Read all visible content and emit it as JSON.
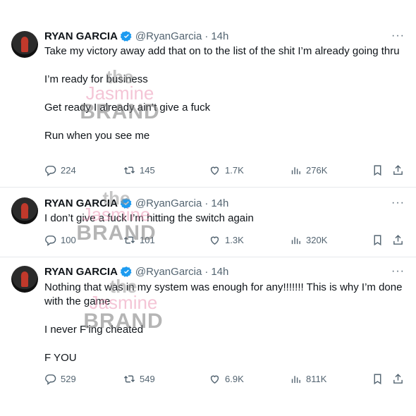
{
  "tweets": [
    {
      "name": "RYAN GARCIA",
      "handle": "@RyanGarcia",
      "dot": "·",
      "time": "14h",
      "lines": [
        "Take my victory away add that on to the list of the shit I’m already going thru",
        "",
        "I’m ready for business",
        "",
        "Get ready I already ain’t give a fuck",
        "",
        "Run when you see me"
      ],
      "replies": "224",
      "retweets": "145",
      "likes": "1.7K",
      "views": "276K"
    },
    {
      "name": "RYAN GARCIA",
      "handle": "@RyanGarcia",
      "dot": "·",
      "time": "14h",
      "lines": [
        "I don’t give a fuck I’m hitting the switch again"
      ],
      "replies": "100",
      "retweets": "101",
      "likes": "1.3K",
      "views": "320K"
    },
    {
      "name": "RYAN GARCIA",
      "handle": "@RyanGarcia",
      "dot": "·",
      "time": "14h",
      "lines": [
        "Nothing that was in my system was enough for any!!!!!!! This is why I’m done with the game",
        "",
        "I never F’ing cheated",
        "",
        "F YOU"
      ],
      "replies": "529",
      "retweets": "549",
      "likes": "6.9K",
      "views": "811K"
    }
  ],
  "more_label": "···",
  "watermark": {
    "line1": "the",
    "line2": "Jasmine",
    "line3": "BRAND"
  },
  "colors": {
    "verified": "#1d9bf0",
    "muted": "#536471",
    "censor": "#e0244e"
  }
}
